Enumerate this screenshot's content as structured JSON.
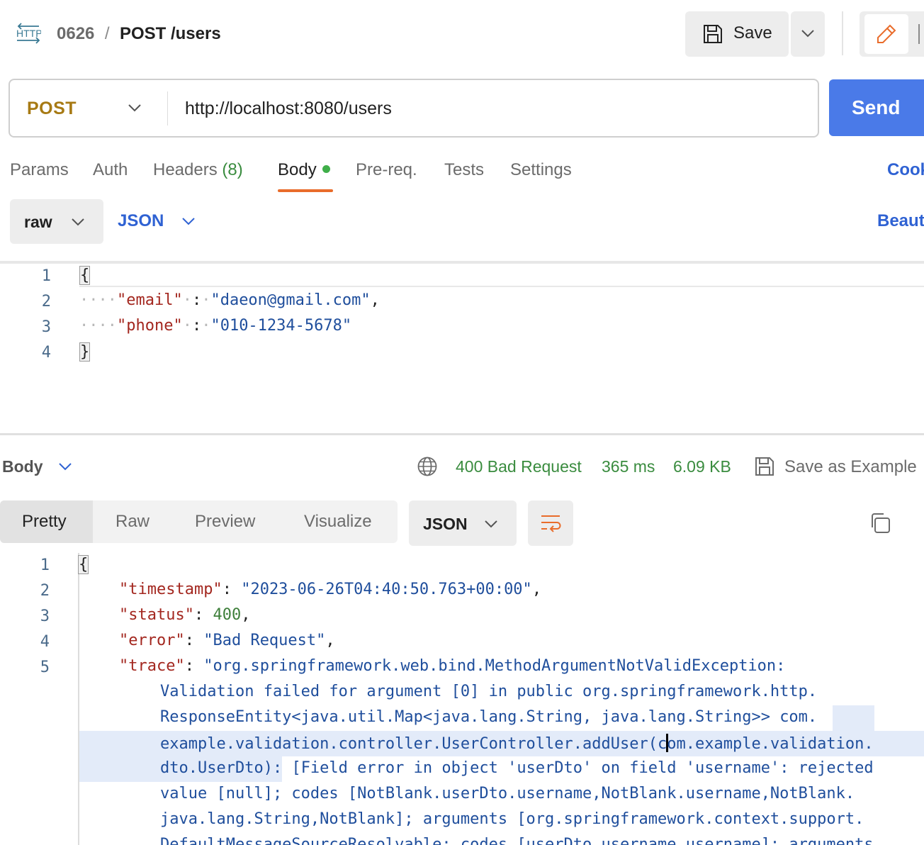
{
  "header": {
    "protocol_icon_text": "HTTP",
    "collection_prefix": "0626",
    "separator": "/",
    "request_title": "POST /users",
    "save_label": "Save"
  },
  "request": {
    "method": "POST",
    "url": "http://localhost:8080/users",
    "send_label": "Send"
  },
  "tabs": [
    {
      "label": "Params"
    },
    {
      "label": "Auth"
    },
    {
      "label": "Headers",
      "count": "(8)"
    },
    {
      "label": "Body",
      "active": true
    },
    {
      "label": "Pre-req."
    },
    {
      "label": "Tests"
    },
    {
      "label": "Settings"
    }
  ],
  "cookies_label": "Cookies",
  "body_mode": {
    "mode": "raw",
    "language": "JSON",
    "beautify_label": "Beautify"
  },
  "request_body": {
    "line_numbers": [
      "1",
      "2",
      "3",
      "4"
    ],
    "open_brace": "{",
    "close_brace": "}",
    "lines": [
      {
        "key": "\"email\"",
        "value": "\"daeon@gmail.com\"",
        "trail": ","
      },
      {
        "key": "\"phone\"",
        "value": "\"010-1234-5678\"",
        "trail": ""
      }
    ]
  },
  "response": {
    "section_label": "Body",
    "status": "400 Bad Request",
    "time": "365 ms",
    "size": "6.09 KB",
    "save_example_label": "Save as Example",
    "view_tabs": [
      "Pretty",
      "Raw",
      "Preview",
      "Visualize"
    ],
    "format": "JSON",
    "line_numbers": [
      "1",
      "2",
      "3",
      "4",
      "5"
    ],
    "open_brace": "{",
    "timestamp_key": "\"timestamp\"",
    "timestamp_value": "\"2023-06-26T04:40:50.763+00:00\"",
    "status_key": "\"status\"",
    "status_value": "400",
    "error_key": "\"error\"",
    "error_value": "\"Bad Request\"",
    "trace_key": "\"trace\"",
    "trace_lines": [
      "\"org.springframework.web.bind.MethodArgumentNotValidException:",
      "Validation failed for argument [0] in public org.springframework.http.",
      "ResponseEntity<java.util.Map<java.lang.String, java.lang.String>> ",
      "com.",
      "example.validation.controller.UserController.addUser(c",
      "om.example.validation.",
      "dto.UserDto)",
      ": [Field error in object 'userDto' on field 'username': rejected",
      "value [null]; codes [NotBlank.userDto.username,NotBlank.username,NotBlank.",
      "java.lang.String,NotBlank]; arguments [org.springframework.context.support.",
      "DefaultMessageSourceResolvable: codes [userDto.username,username]; arguments"
    ]
  }
}
